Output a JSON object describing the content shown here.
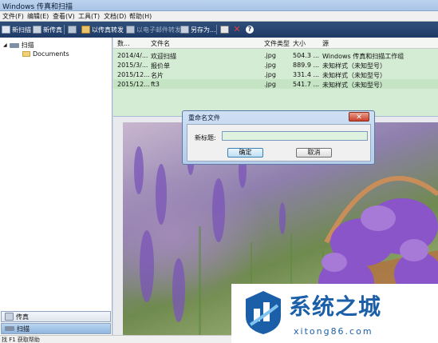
{
  "window": {
    "title": "Windows 传真和扫描"
  },
  "menu": [
    "文件(F)",
    "编辑(E)",
    "查看(V)",
    "工具(T)",
    "文档(D)",
    "帮助(H)"
  ],
  "toolbar": {
    "new_scan": "新扫描",
    "new_fax": "新传真",
    "forward_fax": "以传真转发",
    "forward_email": "以电子邮件转发",
    "save_as": "另存为..."
  },
  "tree": {
    "root": "扫描",
    "child": "Documents"
  },
  "nav": {
    "fax": "传真",
    "scan": "扫描"
  },
  "file_list": {
    "headers": [
      "数...",
      "文件名",
      "文件类型",
      "大小",
      "源"
    ],
    "rows": [
      [
        "2014/4/...",
        "欢迎扫描",
        ".jpg",
        "504.3 ...",
        "Windows 传真和扫描工作组"
      ],
      [
        "2015/3/...",
        "报价单",
        ".jpg",
        "889.9 ...",
        "未知样式（未知型号）"
      ],
      [
        "2015/12...",
        "名片",
        ".jpg",
        "331.4 ...",
        "未知样式（未知型号）"
      ],
      [
        "2015/12...",
        "ft3",
        ".jpg",
        "541.7 ...",
        "未知样式（未知型号）"
      ]
    ]
  },
  "dialog": {
    "title": "重命名文件",
    "label": "新标题:",
    "value": "",
    "ok": "确定",
    "cancel": "取消"
  },
  "status": {
    "text": "找 F1 获取帮助"
  },
  "watermark": {
    "brand": "系统之城",
    "url": "xitong86.com"
  },
  "colors": {
    "toolbar": "#1e3a66",
    "list_bg": "#d4ecd4",
    "brand": "#1b5fa8"
  }
}
